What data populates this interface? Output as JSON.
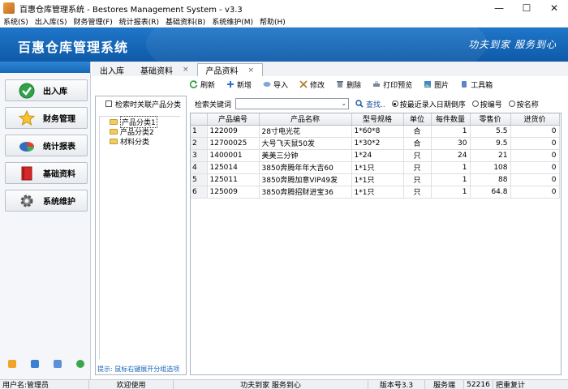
{
  "window": {
    "title": "百惠仓库管理系统 - Bestores Management System - v3.3",
    "minimize": "—",
    "maximize": "☐",
    "close": "✕"
  },
  "menu": [
    "系统(S)",
    "出入库(S)",
    "财务管理(F)",
    "统计报表(R)",
    "基础资料(B)",
    "系统维护(M)",
    "帮助(H)"
  ],
  "banner": {
    "title": "百惠仓库管理系统",
    "slogan": "功夫到家 服务到心"
  },
  "nav": [
    {
      "label": "出入库",
      "icon": "check-icon"
    },
    {
      "label": "财务管理",
      "icon": "star-icon"
    },
    {
      "label": "统计报表",
      "icon": "pie-chart-icon"
    },
    {
      "label": "基础资料",
      "icon": "book-icon"
    },
    {
      "label": "系统维护",
      "icon": "gear-icon"
    }
  ],
  "tabs": [
    {
      "label": "出入库",
      "closable": false,
      "active": false
    },
    {
      "label": "基础资料",
      "closable": true,
      "active": false
    },
    {
      "label": "产品资料",
      "closable": true,
      "active": true
    }
  ],
  "toolbar": {
    "refresh": "刷新",
    "add": "新增",
    "import": "导入",
    "edit": "修改",
    "delete": "删除",
    "print_preview": "打印预览",
    "image": "图片",
    "toolbox": "工具箱"
  },
  "category_panel": {
    "search_related": "检索时关联产品分类",
    "items": [
      "产品分类1",
      "产品分类2",
      "材料分类"
    ],
    "hint": "提示: 鼠标右键展开分组选项"
  },
  "search": {
    "label": "检索关键词",
    "value": "",
    "button": "查找..",
    "options": [
      "按最近录入日期倒序",
      "按编号",
      "按名称"
    ],
    "selected": 0
  },
  "grid": {
    "columns": [
      "",
      "产品编号",
      "产品名称",
      "型号规格",
      "单位",
      "每件数量",
      "零售价",
      "进货价"
    ],
    "rows": [
      [
        "1",
        "122009",
        "28寸电光花",
        "1*60*8",
        "合",
        "1",
        "5.5",
        "0"
      ],
      [
        "2",
        "12700025",
        "大号飞天鼠50发",
        "1*30*2",
        "合",
        "30",
        "9.5",
        "0"
      ],
      [
        "3",
        "1400001",
        "美美三分钟",
        "1*24",
        "只",
        "24",
        "21",
        "0"
      ],
      [
        "4",
        "125014",
        "3850奔腾年年大吉60",
        "1*1只",
        "只",
        "1",
        "108",
        "0"
      ],
      [
        "5",
        "125011",
        "3850奔腾加意VIP49发",
        "1*1只",
        "只",
        "1",
        "88",
        "0"
      ],
      [
        "6",
        "125009",
        "3850奔腾招财进宝36",
        "1*1只",
        "只",
        "1",
        "64.8",
        "0"
      ]
    ]
  },
  "status": {
    "user": "用户名:管理员",
    "welcome": "欢迎使用",
    "slogan": "功夫到家 服务到心",
    "version": "版本号3.3",
    "service": "服务端",
    "port": "52216",
    "extra": "把重复计"
  },
  "colors": {
    "banner": "#1565b8",
    "accent_link": "#1a56a0"
  }
}
